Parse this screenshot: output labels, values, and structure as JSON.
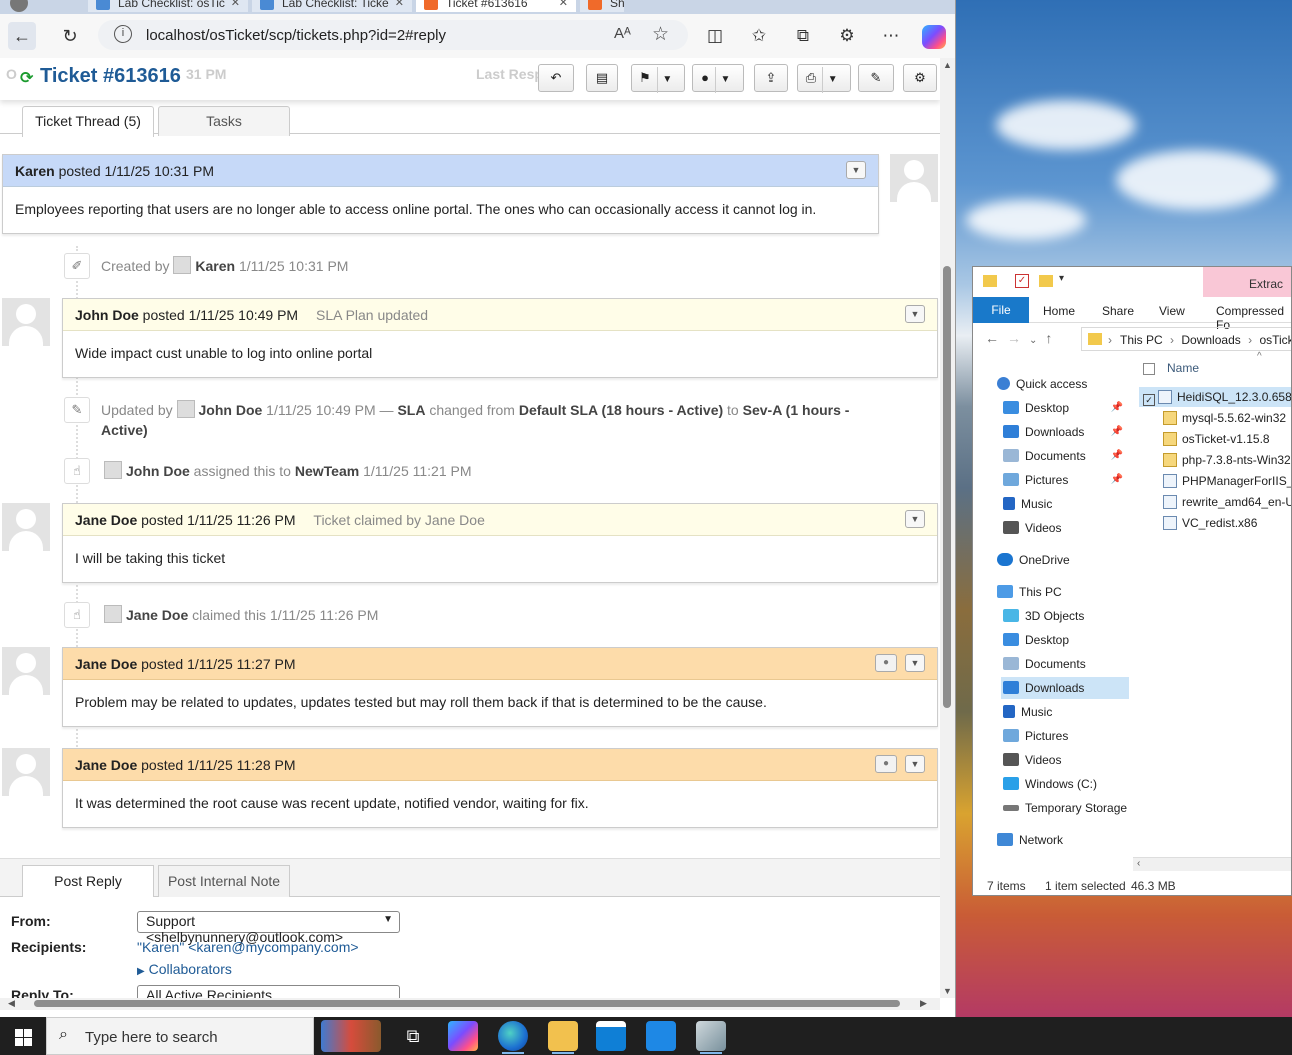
{
  "browser": {
    "tabs": [
      {
        "label": "Lab Checklist: osTic"
      },
      {
        "label": "Lab Checklist: Ticke"
      },
      {
        "label": "Ticket #613616"
      },
      {
        "label": "Sho"
      }
    ],
    "url": "localhost/osTicket/scp/tickets.php?id=2#reply",
    "read_aloud": "Aᴬ",
    "icons": [
      "back-arrow",
      "refresh",
      "info",
      "read-aloud",
      "favorite-star",
      "split-screen",
      "favorites",
      "collections",
      "extensions",
      "more",
      "copilot"
    ]
  },
  "ticket": {
    "title": "Ticket #613616",
    "ghost_left": "O",
    "ghost_time": "31 PM",
    "ghost_last": "Last Resp",
    "tabs": [
      "Ticket Thread (5)",
      "Tasks"
    ]
  },
  "thread": {
    "entries": [
      {
        "author": "Karen",
        "posted": "posted 1/11/25 10:31 PM",
        "extra": "",
        "body": "Employees reporting that users are no longer able to access online portal. The ones who can occasionally access it cannot log in."
      },
      {
        "author": "John Doe",
        "posted": "posted 1/11/25 10:49 PM",
        "extra": "SLA Plan updated",
        "body": "Wide impact cust unable to log into online portal"
      },
      {
        "author": "Jane Doe",
        "posted": "posted 1/11/25 11:26 PM",
        "extra": "Ticket claimed by Jane Doe",
        "body": "I will be taking this ticket"
      },
      {
        "author": "Jane Doe",
        "posted": "posted 1/11/25 11:27 PM",
        "extra": "",
        "body": "Problem may be related to updates, updates tested but may roll them back if that is determined to be the cause."
      },
      {
        "author": "Jane Doe",
        "posted": "posted 1/11/25 11:28 PM",
        "extra": "",
        "body": "It was determined the root cause was recent update, notified vendor, waiting for fix."
      }
    ],
    "events": {
      "created": {
        "prefix": "Created by",
        "who": "Karen",
        "when": "1/11/25 10:31 PM"
      },
      "updated": {
        "prefix": "Updated by",
        "who": "John Doe",
        "when": "1/11/25 10:49 PM —",
        "field": "SLA",
        "mid": "changed from",
        "from": "Default SLA (18 hours - Active)",
        "to_word": "to",
        "to": "Sev-A (1 hours - Active)"
      },
      "assigned": {
        "who": "John Doe",
        "mid": "assigned this to",
        "team": "NewTeam",
        "when": "1/11/25 11:21 PM"
      },
      "claimed": {
        "who": "Jane Doe",
        "mid": "claimed this",
        "when": "1/11/25 11:26 PM"
      }
    }
  },
  "reply": {
    "tabs": [
      "Post Reply",
      "Post Internal Note"
    ],
    "from_label": "From:",
    "from_value": "Support <shelbynunnery@outlook.com>",
    "recipients_label": "Recipients:",
    "recipients_value": "\"Karen\" <karen@mycompany.com>",
    "collaborators": "Collaborators",
    "replyto_label": "Reply To:",
    "replyto_value": "All Active Recipients"
  },
  "explorer": {
    "extract_tab": "Extrac",
    "ribbon": [
      "File",
      "Home",
      "Share",
      "View",
      "Compressed Fo"
    ],
    "path": [
      "This PC",
      "Downloads",
      "osTick"
    ],
    "column_name": "Name",
    "nav": [
      {
        "label": "Quick access",
        "pinned": false
      },
      {
        "label": "Desktop",
        "pinned": true
      },
      {
        "label": "Downloads",
        "pinned": true
      },
      {
        "label": "Documents",
        "pinned": true
      },
      {
        "label": "Pictures",
        "pinned": true
      },
      {
        "label": "Music",
        "pinned": false
      },
      {
        "label": "Videos",
        "pinned": false
      },
      {
        "label": "OneDrive",
        "pinned": false
      },
      {
        "label": "This PC",
        "pinned": false
      },
      {
        "label": "3D Objects",
        "pinned": false
      },
      {
        "label": "Desktop",
        "pinned": false
      },
      {
        "label": "Documents",
        "pinned": false
      },
      {
        "label": "Downloads",
        "pinned": false
      },
      {
        "label": "Music",
        "pinned": false
      },
      {
        "label": "Pictures",
        "pinned": false
      },
      {
        "label": "Videos",
        "pinned": false
      },
      {
        "label": "Windows (C:)",
        "pinned": false
      },
      {
        "label": "Temporary Storage",
        "pinned": false
      },
      {
        "label": "Network",
        "pinned": false
      }
    ],
    "files": [
      "HeidiSQL_12.3.0.658",
      "mysql-5.5.62-win32",
      "osTicket-v1.15.8",
      "php-7.3.8-nts-Win32",
      "PHPManagerForIIS_V",
      "rewrite_amd64_en-U",
      "VC_redist.x86"
    ],
    "status_items": "7 items",
    "status_selected": "1 item selected",
    "status_size": "46.3 MB"
  },
  "taskbar": {
    "search_placeholder": "Type here to search",
    "icons": [
      "windows-start",
      "search",
      "widgets",
      "task-view",
      "copilot",
      "edge",
      "file-explorer",
      "store",
      "mail",
      "app"
    ]
  }
}
